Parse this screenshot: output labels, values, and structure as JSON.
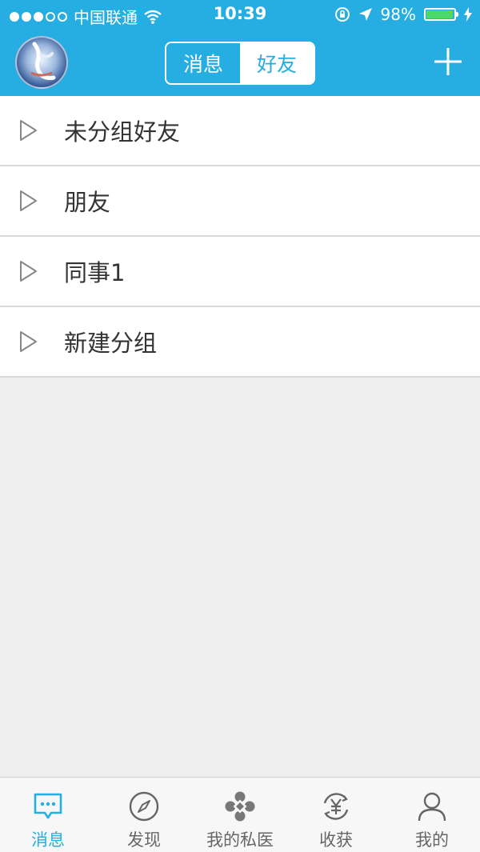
{
  "status_bar": {
    "carrier": "中国联通",
    "time": "10:39",
    "battery_percent": "98%",
    "battery_level": 0.98,
    "signal_strength": 3,
    "signal_max": 5
  },
  "header": {
    "segments": [
      "消息",
      "好友"
    ],
    "active_segment": "好友",
    "add_icon": "plus-icon"
  },
  "groups": [
    {
      "label": "未分组好友",
      "icon": "triangle-right-icon"
    },
    {
      "label": "朋友",
      "icon": "triangle-right-icon"
    },
    {
      "label": "同事1",
      "icon": "triangle-right-icon"
    },
    {
      "label": "新建分组",
      "icon": "triangle-right-icon"
    }
  ],
  "tabbar": {
    "items": [
      {
        "label": "消息",
        "icon": "chat-bubble-icon",
        "active": true
      },
      {
        "label": "发现",
        "icon": "compass-icon",
        "active": false
      },
      {
        "label": "我的私医",
        "icon": "medical-cross-icon",
        "active": false
      },
      {
        "label": "收获",
        "icon": "yuan-coin-icon",
        "active": false
      },
      {
        "label": "我的",
        "icon": "person-icon",
        "active": false
      }
    ]
  },
  "colors": {
    "accent": "#26aee3",
    "battery": "#4cd964",
    "background": "#efefef",
    "tab_inactive": "#666666"
  }
}
